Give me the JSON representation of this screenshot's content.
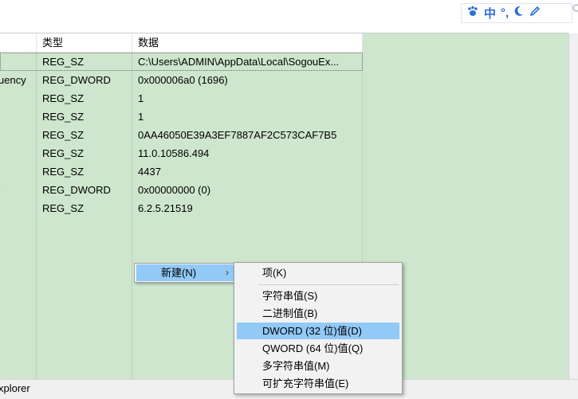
{
  "ime": {
    "paw_icon": "paw-icon",
    "lang": "中",
    "punct": "°,",
    "moon_icon": "moon-icon",
    "pen_icon": "pen-icon"
  },
  "columns": {
    "type": "类型",
    "data": "数据"
  },
  "rows": [
    {
      "name": "",
      "type": "REG_SZ",
      "data": "C:\\Users\\ADMIN\\AppData\\Local\\SogouEx..."
    },
    {
      "name": "uency",
      "type": "REG_DWORD",
      "data": "0x000006a0 (1696)"
    },
    {
      "name": "",
      "type": "REG_SZ",
      "data": "1"
    },
    {
      "name": "",
      "type": "REG_SZ",
      "data": "1"
    },
    {
      "name": "",
      "type": "REG_SZ",
      "data": "0AA46050E39A3EF7887AF2C573CAF7B5"
    },
    {
      "name": "",
      "type": "REG_SZ",
      "data": "11.0.10586.494"
    },
    {
      "name": "",
      "type": "REG_SZ",
      "data": "4437"
    },
    {
      "name": "i",
      "type": "REG_DWORD",
      "data": "0x00000000 (0)"
    },
    {
      "name": "",
      "type": "REG_SZ",
      "data": "6.2.5.21519"
    }
  ],
  "statusbar": {
    "text": "xplorer"
  },
  "context_menu": {
    "new_label": "新建(N)",
    "arrow": "›"
  },
  "submenu": {
    "key": "项(K)",
    "string": "字符串值(S)",
    "binary": "二进制值(B)",
    "dword": "DWORD (32 位)值(D)",
    "qword": "QWORD (64 位)值(Q)",
    "multi_string": "多字符串值(M)",
    "expandable_string": "可扩充字符串值(E)"
  },
  "colors": {
    "list_background": "#cde6cd",
    "menu_highlight": "#91c9f7",
    "ime_icon": "#2d6fd6"
  }
}
